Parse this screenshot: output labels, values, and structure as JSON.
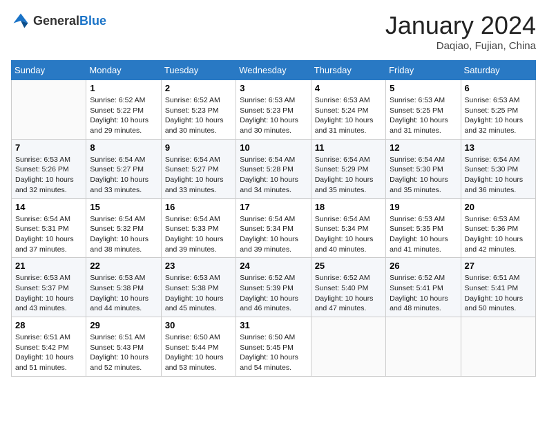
{
  "header": {
    "logo_general": "General",
    "logo_blue": "Blue",
    "month_year": "January 2024",
    "location": "Daqiao, Fujian, China"
  },
  "weekdays": [
    "Sunday",
    "Monday",
    "Tuesday",
    "Wednesday",
    "Thursday",
    "Friday",
    "Saturday"
  ],
  "weeks": [
    [
      {
        "day": "",
        "content": ""
      },
      {
        "day": "1",
        "content": "Sunrise: 6:52 AM\nSunset: 5:22 PM\nDaylight: 10 hours\nand 29 minutes."
      },
      {
        "day": "2",
        "content": "Sunrise: 6:52 AM\nSunset: 5:23 PM\nDaylight: 10 hours\nand 30 minutes."
      },
      {
        "day": "3",
        "content": "Sunrise: 6:53 AM\nSunset: 5:23 PM\nDaylight: 10 hours\nand 30 minutes."
      },
      {
        "day": "4",
        "content": "Sunrise: 6:53 AM\nSunset: 5:24 PM\nDaylight: 10 hours\nand 31 minutes."
      },
      {
        "day": "5",
        "content": "Sunrise: 6:53 AM\nSunset: 5:25 PM\nDaylight: 10 hours\nand 31 minutes."
      },
      {
        "day": "6",
        "content": "Sunrise: 6:53 AM\nSunset: 5:25 PM\nDaylight: 10 hours\nand 32 minutes."
      }
    ],
    [
      {
        "day": "7",
        "content": "Sunrise: 6:53 AM\nSunset: 5:26 PM\nDaylight: 10 hours\nand 32 minutes."
      },
      {
        "day": "8",
        "content": "Sunrise: 6:54 AM\nSunset: 5:27 PM\nDaylight: 10 hours\nand 33 minutes."
      },
      {
        "day": "9",
        "content": "Sunrise: 6:54 AM\nSunset: 5:27 PM\nDaylight: 10 hours\nand 33 minutes."
      },
      {
        "day": "10",
        "content": "Sunrise: 6:54 AM\nSunset: 5:28 PM\nDaylight: 10 hours\nand 34 minutes."
      },
      {
        "day": "11",
        "content": "Sunrise: 6:54 AM\nSunset: 5:29 PM\nDaylight: 10 hours\nand 35 minutes."
      },
      {
        "day": "12",
        "content": "Sunrise: 6:54 AM\nSunset: 5:30 PM\nDaylight: 10 hours\nand 35 minutes."
      },
      {
        "day": "13",
        "content": "Sunrise: 6:54 AM\nSunset: 5:30 PM\nDaylight: 10 hours\nand 36 minutes."
      }
    ],
    [
      {
        "day": "14",
        "content": "Sunrise: 6:54 AM\nSunset: 5:31 PM\nDaylight: 10 hours\nand 37 minutes."
      },
      {
        "day": "15",
        "content": "Sunrise: 6:54 AM\nSunset: 5:32 PM\nDaylight: 10 hours\nand 38 minutes."
      },
      {
        "day": "16",
        "content": "Sunrise: 6:54 AM\nSunset: 5:33 PM\nDaylight: 10 hours\nand 39 minutes."
      },
      {
        "day": "17",
        "content": "Sunrise: 6:54 AM\nSunset: 5:34 PM\nDaylight: 10 hours\nand 39 minutes."
      },
      {
        "day": "18",
        "content": "Sunrise: 6:54 AM\nSunset: 5:34 PM\nDaylight: 10 hours\nand 40 minutes."
      },
      {
        "day": "19",
        "content": "Sunrise: 6:53 AM\nSunset: 5:35 PM\nDaylight: 10 hours\nand 41 minutes."
      },
      {
        "day": "20",
        "content": "Sunrise: 6:53 AM\nSunset: 5:36 PM\nDaylight: 10 hours\nand 42 minutes."
      }
    ],
    [
      {
        "day": "21",
        "content": "Sunrise: 6:53 AM\nSunset: 5:37 PM\nDaylight: 10 hours\nand 43 minutes."
      },
      {
        "day": "22",
        "content": "Sunrise: 6:53 AM\nSunset: 5:38 PM\nDaylight: 10 hours\nand 44 minutes."
      },
      {
        "day": "23",
        "content": "Sunrise: 6:53 AM\nSunset: 5:38 PM\nDaylight: 10 hours\nand 45 minutes."
      },
      {
        "day": "24",
        "content": "Sunrise: 6:52 AM\nSunset: 5:39 PM\nDaylight: 10 hours\nand 46 minutes."
      },
      {
        "day": "25",
        "content": "Sunrise: 6:52 AM\nSunset: 5:40 PM\nDaylight: 10 hours\nand 47 minutes."
      },
      {
        "day": "26",
        "content": "Sunrise: 6:52 AM\nSunset: 5:41 PM\nDaylight: 10 hours\nand 48 minutes."
      },
      {
        "day": "27",
        "content": "Sunrise: 6:51 AM\nSunset: 5:41 PM\nDaylight: 10 hours\nand 50 minutes."
      }
    ],
    [
      {
        "day": "28",
        "content": "Sunrise: 6:51 AM\nSunset: 5:42 PM\nDaylight: 10 hours\nand 51 minutes."
      },
      {
        "day": "29",
        "content": "Sunrise: 6:51 AM\nSunset: 5:43 PM\nDaylight: 10 hours\nand 52 minutes."
      },
      {
        "day": "30",
        "content": "Sunrise: 6:50 AM\nSunset: 5:44 PM\nDaylight: 10 hours\nand 53 minutes."
      },
      {
        "day": "31",
        "content": "Sunrise: 6:50 AM\nSunset: 5:45 PM\nDaylight: 10 hours\nand 54 minutes."
      },
      {
        "day": "",
        "content": ""
      },
      {
        "day": "",
        "content": ""
      },
      {
        "day": "",
        "content": ""
      }
    ]
  ]
}
